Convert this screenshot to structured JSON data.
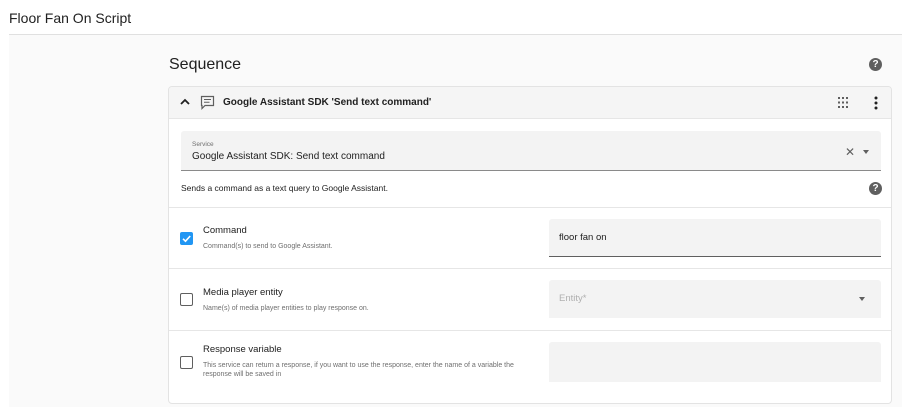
{
  "page": {
    "title": "Floor Fan On Script"
  },
  "sequence": {
    "title": "Sequence",
    "help_icon": "help-circle-icon"
  },
  "action_card": {
    "title": "Google Assistant SDK 'Send text command'",
    "icons": {
      "collapse": "chevron-up-icon",
      "type": "message-text-icon",
      "drag": "drag-handle-icon",
      "menu": "more-vertical-icon"
    },
    "service": {
      "label": "Service",
      "value": "Google Assistant SDK: Send text command",
      "clear_icon": "close-icon",
      "dropdown_icon": "menu-down-icon"
    },
    "description": "Sends a command as a text query to Google Assistant.",
    "fields": [
      {
        "title": "Command",
        "description": "Command(s) to send to Google Assistant.",
        "checked": true,
        "value": "floor fan on"
      },
      {
        "title": "Media player entity",
        "description": "Name(s) of media player entities to play response on.",
        "checked": false,
        "placeholder": "Entity*"
      },
      {
        "title": "Response variable",
        "description": "This service can return a response, if you want to use the response, enter the name of a variable the response will be saved in",
        "checked": false,
        "value": ""
      }
    ]
  },
  "colors": {
    "accent": "#2196f3",
    "icon": "#5f5f5f",
    "field_bg": "#f3f3f3",
    "header_bg": "#f5f5f5"
  }
}
